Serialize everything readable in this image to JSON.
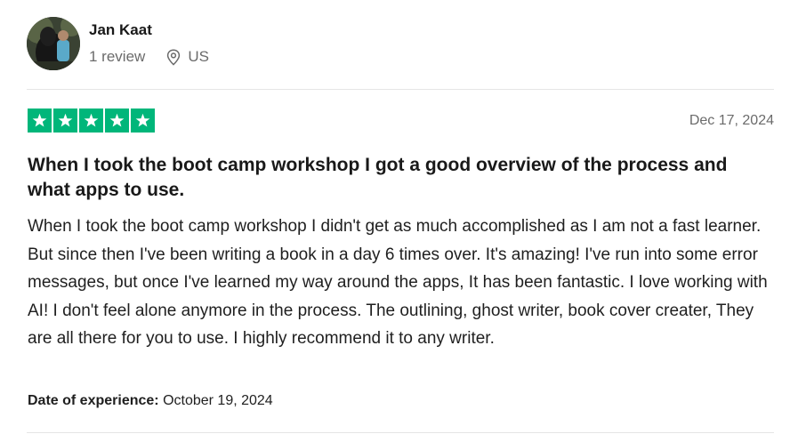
{
  "reviewer": {
    "name": "Jan Kaat",
    "review_count": "1 review",
    "location": "US",
    "location_icon": "map-pin-icon"
  },
  "review": {
    "rating": 5,
    "max_rating": 5,
    "star_color": "#00b67a",
    "date": "Dec 17, 2024",
    "title": "When I took the boot camp workshop I got a good overview of the process and what apps to use.",
    "body": "When I took the boot camp workshop I didn't get as much accomplished as I am not a fast learner. But since then I've been writing a book in a day 6 times over. It's amazing! I've run into some error messages, but once I've learned my way around the apps, It has been fantastic. I love working with AI! I don't feel alone anymore in the process. The outlining, ghost writer, book cover creater, They are all there for you to use. I highly recommend it to any writer.",
    "experience_label": "Date of experience:",
    "experience_date": "October 19, 2024"
  }
}
